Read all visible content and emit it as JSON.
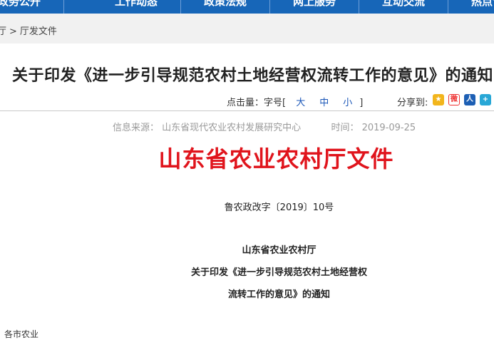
{
  "nav": {
    "items": [
      "政务公开",
      "工作动态",
      "政策法规",
      "网上服务",
      "互动交流",
      "热点专题"
    ]
  },
  "breadcrumb": {
    "prefix": "厅",
    "separator": ">",
    "current": "厅发文件"
  },
  "article": {
    "title": "关于印发《进一步引导规范农村土地经营权流转工作的意见》的通知",
    "hits_label": "点击量：",
    "font_label": "字号[",
    "font_large": "大",
    "font_medium": "中",
    "font_small": "小",
    "font_close": "]",
    "share_label": "分享到:",
    "source_label": "信息来源：",
    "source_value": "山东省现代农业农村发展研究中心",
    "time_label": "时间：",
    "time_value": "2019-09-25"
  },
  "document": {
    "red_heading": "山东省农业农村厅文件",
    "doc_number": "鲁农政改字〔2019〕10号",
    "issuer": "山东省农业农村厅",
    "subject_line1": "关于印发《进一步引导规范农村土地经营权",
    "subject_line2": "流转工作的意见》的通知",
    "partial_bottom": "各市农业"
  },
  "colors": {
    "nav_blue": "#1766b8",
    "red_heading": "#e0141c",
    "link_blue": "#1a56b8"
  },
  "icons": [
    "qzone-icon",
    "weibo-icon",
    "renren-icon",
    "more-share-icon"
  ]
}
